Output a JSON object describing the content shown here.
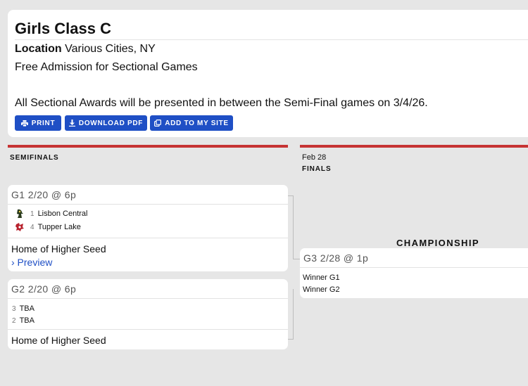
{
  "header": {
    "title": "Girls Class C",
    "location_label": "Location",
    "location_value": "Various Cities, NY",
    "admission": "Free Admission for Sectional Games",
    "awards_note": "All Sectional Awards will be presented in between the Semi-Final games on 3/4/26."
  },
  "buttons": {
    "print": "PRINT",
    "download": "DOWNLOAD PDF",
    "add_site": "ADD TO MY SITE"
  },
  "columns": {
    "semis_label": "SEMIFINALS",
    "finals_date": "Feb 28",
    "finals_label": "FINALS",
    "championship": "CHAMPIONSHIP"
  },
  "games": {
    "g1": {
      "header": "G1 2/20 @ 6p",
      "teams": [
        {
          "seed": "1",
          "name": "Lisbon Central"
        },
        {
          "seed": "4",
          "name": "Tupper Lake"
        }
      ],
      "footer": "Home of Higher Seed",
      "preview": "› Preview"
    },
    "g2": {
      "header": "G2 2/20 @ 6p",
      "teams": [
        {
          "seed": "3",
          "name": "TBA"
        },
        {
          "seed": "2",
          "name": "TBA"
        }
      ],
      "footer": "Home of Higher Seed"
    },
    "g3": {
      "header": "G3 2/28 @ 1p",
      "teams": [
        {
          "name": "Winner G1"
        },
        {
          "name": "Winner G2"
        }
      ]
    }
  },
  "colors": {
    "accent_blue": "#1f4fc5",
    "section_red": "#c63333",
    "background": "#e6e6e6"
  }
}
